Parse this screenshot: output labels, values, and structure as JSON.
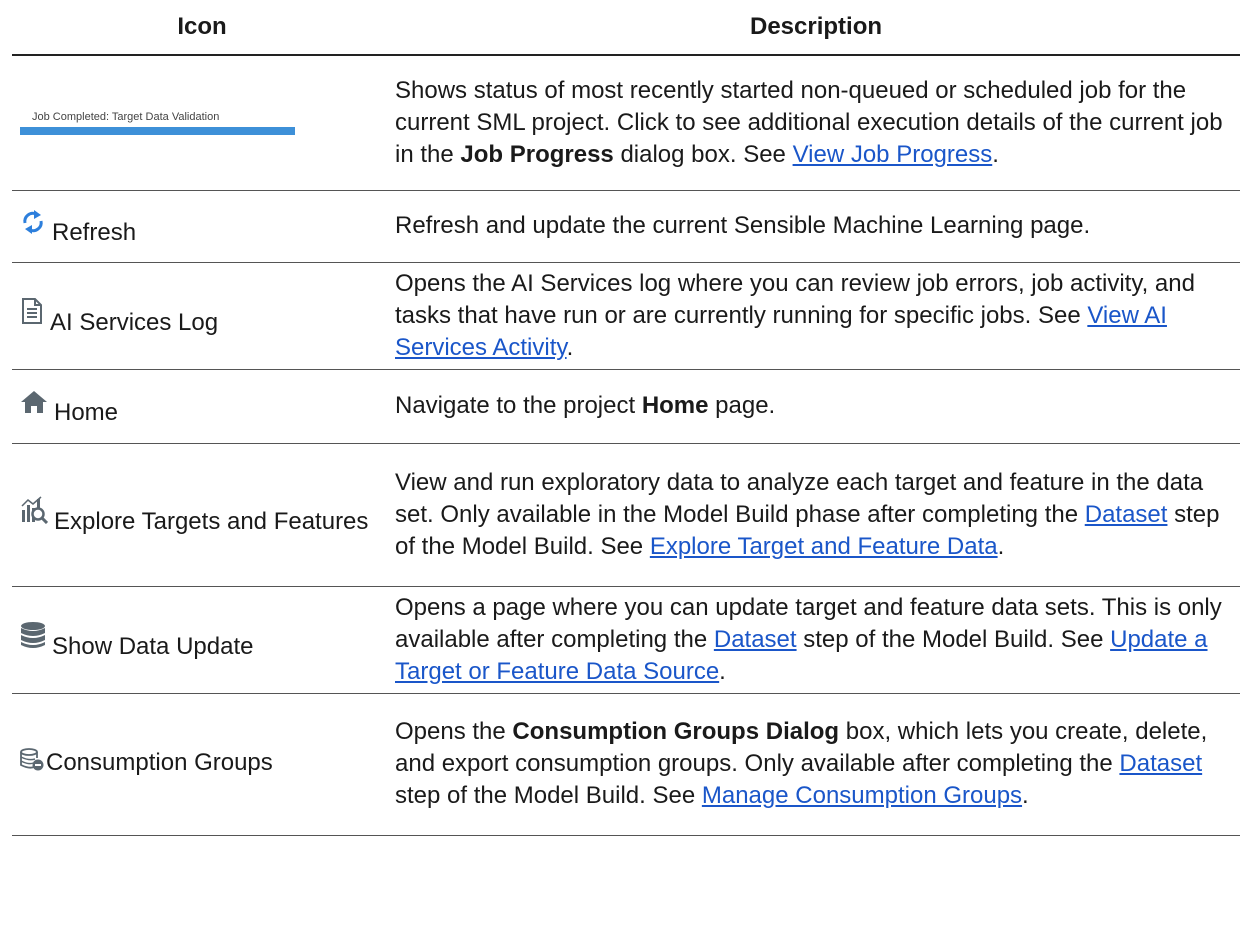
{
  "header": {
    "icon": "Icon",
    "description": "Description"
  },
  "colors": {
    "link": "#1a56c9",
    "progress_bar": "#3d90d8",
    "refresh_icon": "#2d7fdc",
    "icon_gray": "#5b6770"
  },
  "rows": [
    {
      "icon": "job-status-thumbnail",
      "name": "",
      "job_text": "Job Completed: Target Data Validation",
      "desc_1": "Shows status of most recently started non-queued or scheduled job for the current SML project. Click to see additional execution details of the current job in the ",
      "bold_1": "Job Progress",
      "desc_2": " dialog box. See ",
      "link_1": "View Job Progress",
      "desc_3": "."
    },
    {
      "icon": "refresh-icon",
      "name": "Refresh",
      "desc_1": "Refresh and update the current Sensible Machine Learning page."
    },
    {
      "icon": "document-icon",
      "name": "AI Services Log",
      "desc_1": "Opens the AI Services log where you can review job errors, job activity, and tasks that have run or are currently running for specific jobs. See ",
      "link_1": "View AI Services Activity",
      "desc_2": "."
    },
    {
      "icon": "home-icon",
      "name": "Home",
      "desc_1": "Navigate to the project ",
      "bold_1": "Home",
      "desc_2": " page."
    },
    {
      "icon": "explore-chart-icon",
      "name": "Explore Targets and Features",
      "desc_1": "View and run exploratory data to analyze each target and feature in the data set. Only available in the Model Build phase after completing the ",
      "link_1": "Dataset",
      "desc_2": " step of the Model Build. See ",
      "link_2": "Explore Target and Feature Data",
      "desc_3": "."
    },
    {
      "icon": "database-icon",
      "name": "Show Data Update",
      "desc_1": "Opens a page where you can update target and feature data sets. This is only available after completing the ",
      "link_1": "Dataset",
      "desc_2": " step of the Model Build. See ",
      "link_2": "Update a Target or Feature Data Source",
      "desc_3": "."
    },
    {
      "icon": "consumption-groups-icon",
      "name": "Consumption Groups",
      "desc_1": "Opens the ",
      "bold_1": "Consumption Groups Dialog",
      "desc_2": " box, which lets you create, delete, and export consumption groups. Only available after completing the ",
      "link_1": "Dataset",
      "desc_3": " step of the Model Build. See ",
      "link_2": "Manage Consumption Groups",
      "desc_4": "."
    }
  ]
}
